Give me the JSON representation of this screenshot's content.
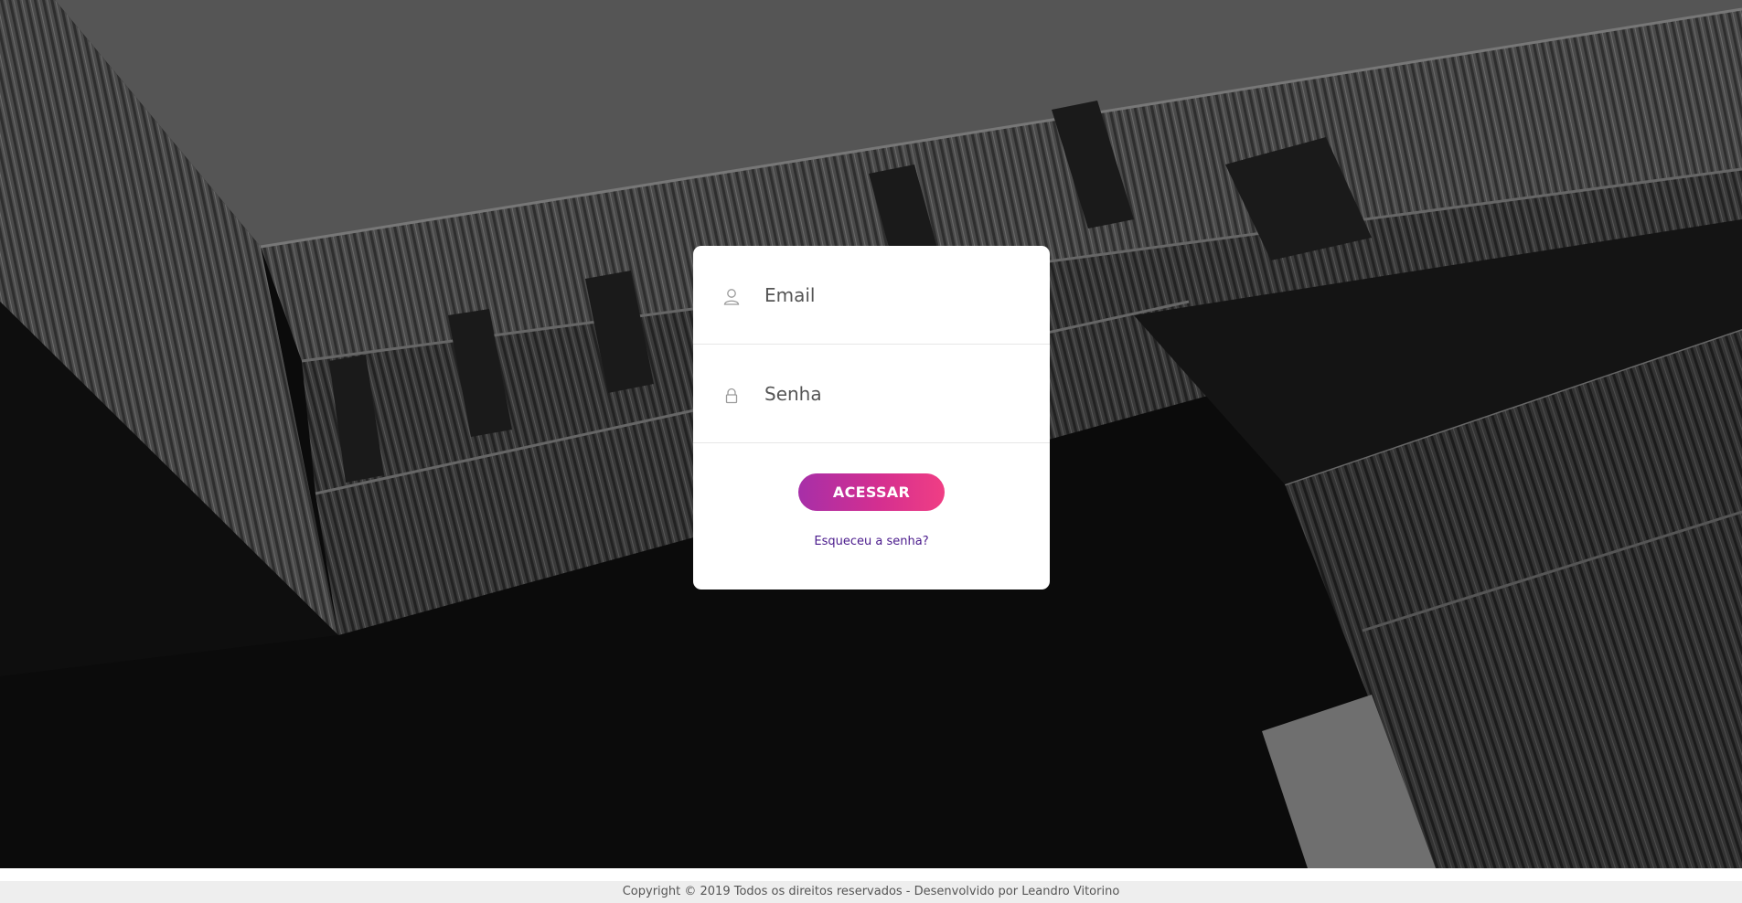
{
  "login": {
    "email_placeholder": "Email",
    "password_placeholder": "Senha",
    "submit_label": "ACESSAR",
    "forgot_label": "Esqueceu a senha?"
  },
  "footer": {
    "text": "Copyright © 2019 Todos os direitos reservados - Desenvolvido por Leandro Vitorino"
  },
  "icons": {
    "email": "user-icon",
    "password": "lock-icon"
  },
  "colors": {
    "button_gradient_start": "#a72fa8",
    "button_gradient_end": "#f03e84",
    "link": "#4a1a8c",
    "footer_bg": "#eeeeee"
  }
}
